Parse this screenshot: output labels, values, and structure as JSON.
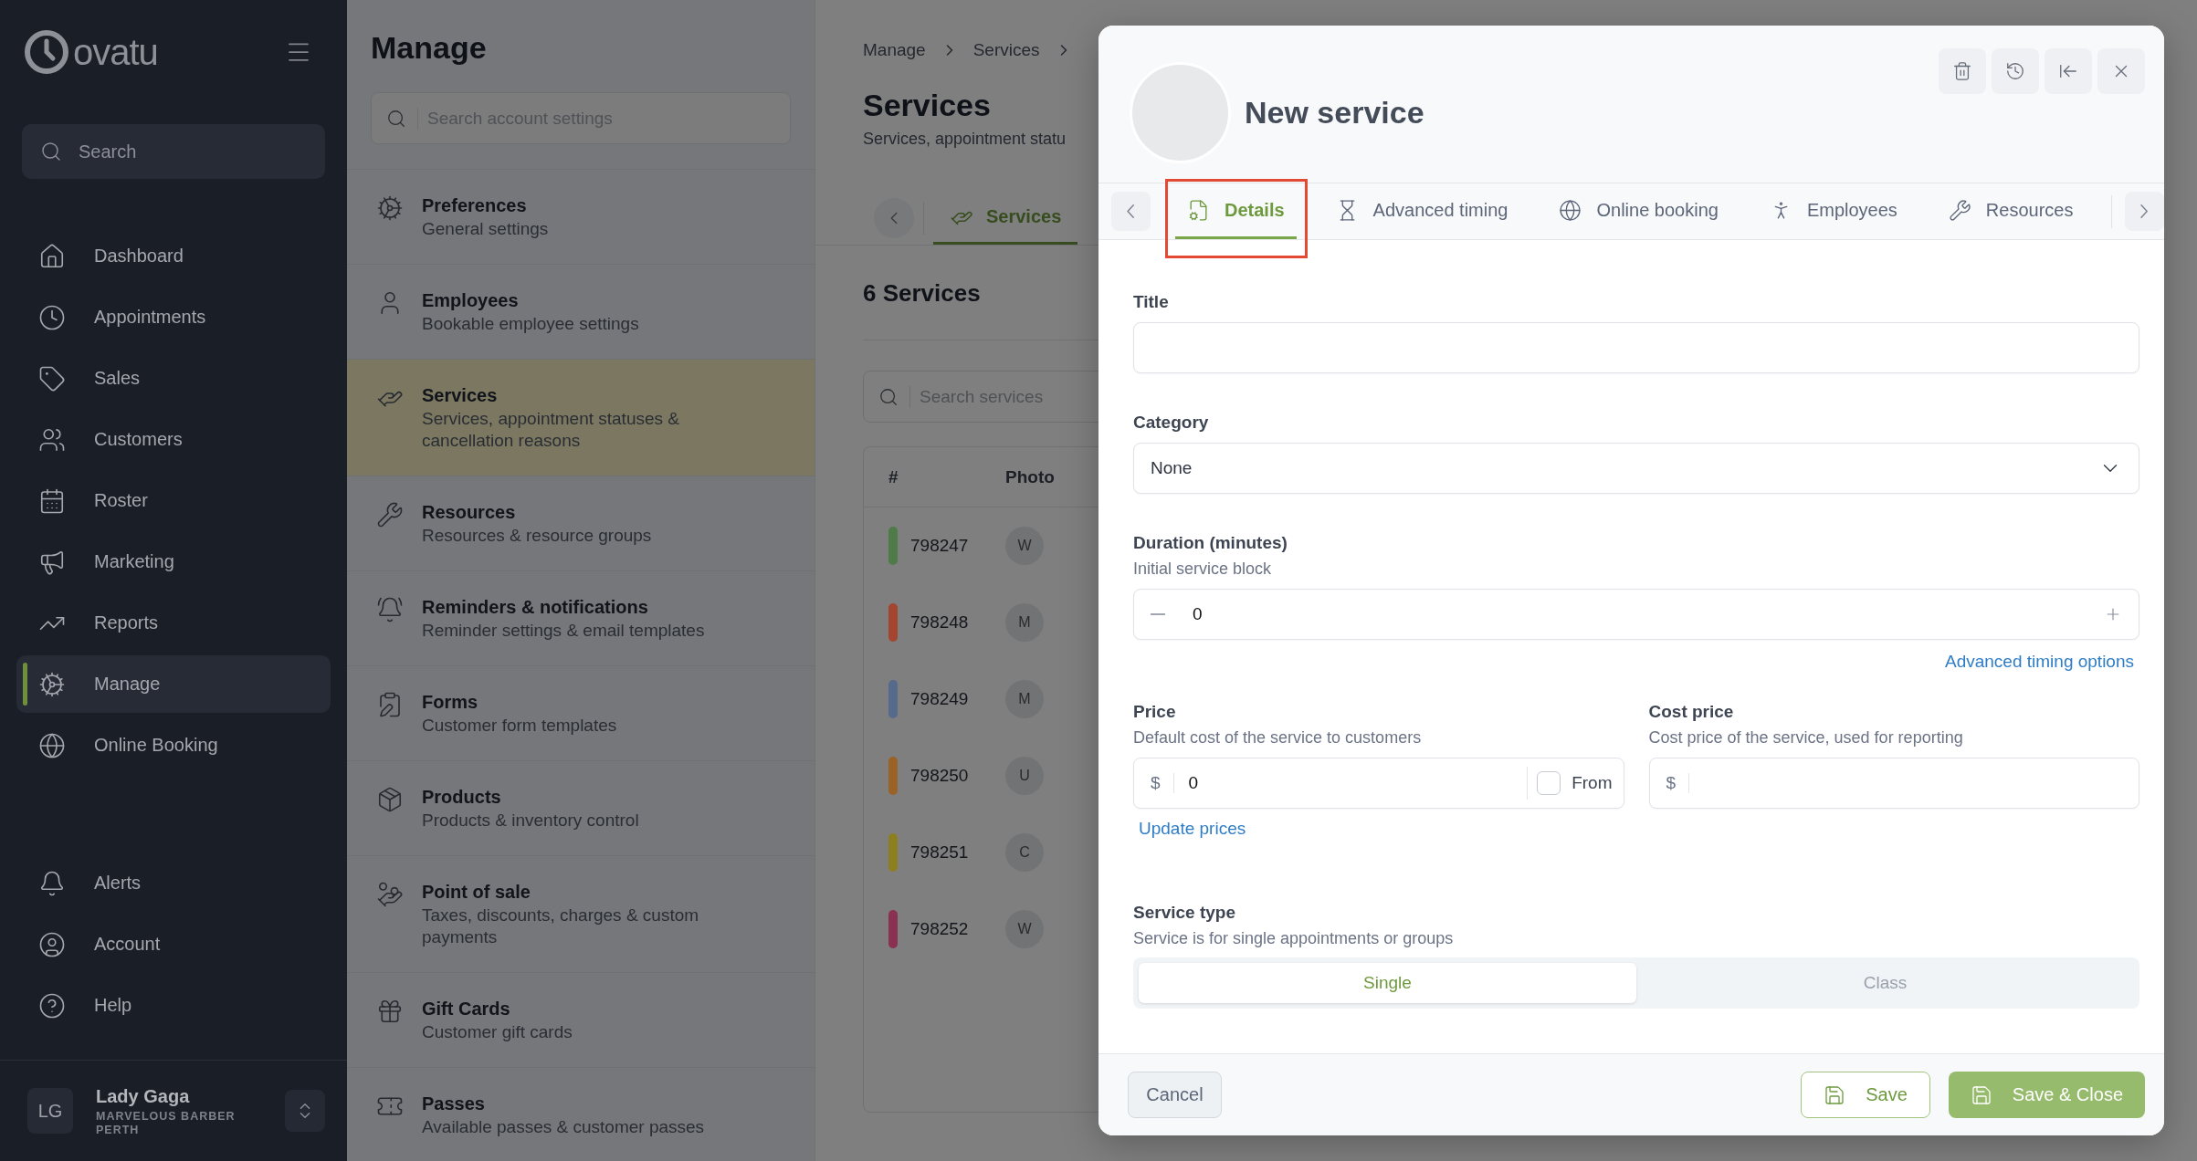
{
  "sidebar": {
    "logo": "ovatu",
    "search": {
      "placeholder": "Search"
    },
    "items": [
      {
        "label": "Dashboard",
        "selected": false
      },
      {
        "label": "Appointments",
        "selected": false
      },
      {
        "label": "Sales",
        "selected": false
      },
      {
        "label": "Customers",
        "selected": false
      },
      {
        "label": "Roster",
        "selected": false
      },
      {
        "label": "Marketing",
        "selected": false
      },
      {
        "label": "Reports",
        "selected": false
      },
      {
        "label": "Manage",
        "selected": true
      },
      {
        "label": "Online Booking",
        "selected": false
      }
    ],
    "bottom_items": [
      {
        "label": "Alerts"
      },
      {
        "label": "Account"
      },
      {
        "label": "Help"
      }
    ],
    "user": {
      "initials": "LG",
      "name": "Lady Gaga",
      "business": "MARVELOUS BARBER PERTH"
    }
  },
  "manage": {
    "title": "Manage",
    "search": {
      "placeholder": "Search account settings"
    },
    "items": [
      {
        "title": "Preferences",
        "subtitle": "General settings",
        "selected": false
      },
      {
        "title": "Employees",
        "subtitle": "Bookable employee settings",
        "selected": false
      },
      {
        "title": "Services",
        "subtitle": "Services, appointment statuses & cancellation reasons",
        "selected": true
      },
      {
        "title": "Resources",
        "subtitle": "Resources & resource groups",
        "selected": false
      },
      {
        "title": "Reminders & notifications",
        "subtitle": "Reminder settings & email templates",
        "selected": false
      },
      {
        "title": "Forms",
        "subtitle": "Customer form templates",
        "selected": false
      },
      {
        "title": "Products",
        "subtitle": "Products & inventory control",
        "selected": false
      },
      {
        "title": "Point of sale",
        "subtitle": "Taxes, discounts, charges & custom payments",
        "selected": false
      },
      {
        "title": "Gift Cards",
        "subtitle": "Customer gift cards",
        "selected": false
      },
      {
        "title": "Passes",
        "subtitle": "Available passes & customer passes",
        "selected": false
      }
    ]
  },
  "services_page": {
    "breadcrumbs": [
      "Manage",
      "Services"
    ],
    "title": "Services",
    "subtitle": "Services, appointment statu",
    "tabs": [
      {
        "label": "Services",
        "selected": true
      }
    ],
    "count": "6 Services",
    "search": {
      "placeholder": "Search services"
    },
    "table": {
      "columns": [
        "#",
        "Photo"
      ],
      "rows": [
        {
          "id": "798247",
          "photo": "W",
          "color": "#4e7b47"
        },
        {
          "id": "798248",
          "photo": "M",
          "color": "#a4452f"
        },
        {
          "id": "798249",
          "photo": "M",
          "color": "#566a8c"
        },
        {
          "id": "798250",
          "photo": "U",
          "color": "#9a6226"
        },
        {
          "id": "798251",
          "photo": "C",
          "color": "#8c7f1f"
        },
        {
          "id": "798252",
          "photo": "W",
          "color": "#8a3050"
        }
      ]
    }
  },
  "modal": {
    "title": "New service",
    "tabs": [
      {
        "label": "Details",
        "selected": true,
        "highlighted": true
      },
      {
        "label": "Advanced timing",
        "selected": false,
        "highlighted": false
      },
      {
        "label": "Online booking",
        "selected": false,
        "highlighted": false
      },
      {
        "label": "Employees",
        "selected": false,
        "highlighted": false
      },
      {
        "label": "Resources",
        "selected": false,
        "highlighted": false
      }
    ],
    "title_field": {
      "label": "Title"
    },
    "category": {
      "label": "Category",
      "value": "None"
    },
    "duration": {
      "label": "Duration (minutes)",
      "hint": "Initial service block",
      "value": "0",
      "link": "Advanced timing options"
    },
    "price": {
      "label": "Price",
      "hint": "Default cost of the service to customers",
      "currency": "$",
      "value": "0",
      "from_label": "From",
      "from_checked": false,
      "link": "Update prices"
    },
    "cost_price": {
      "label": "Cost price",
      "hint": "Cost price of the service, used for reporting",
      "currency": "$"
    },
    "service_type": {
      "label": "Service type",
      "hint": "Service is for single appointments or groups",
      "options": [
        {
          "label": "Single",
          "selected": true
        },
        {
          "label": "Class",
          "selected": false
        }
      ]
    },
    "footer": {
      "cancel": "Cancel",
      "save": "Save",
      "save_close": "Save & Close"
    }
  }
}
